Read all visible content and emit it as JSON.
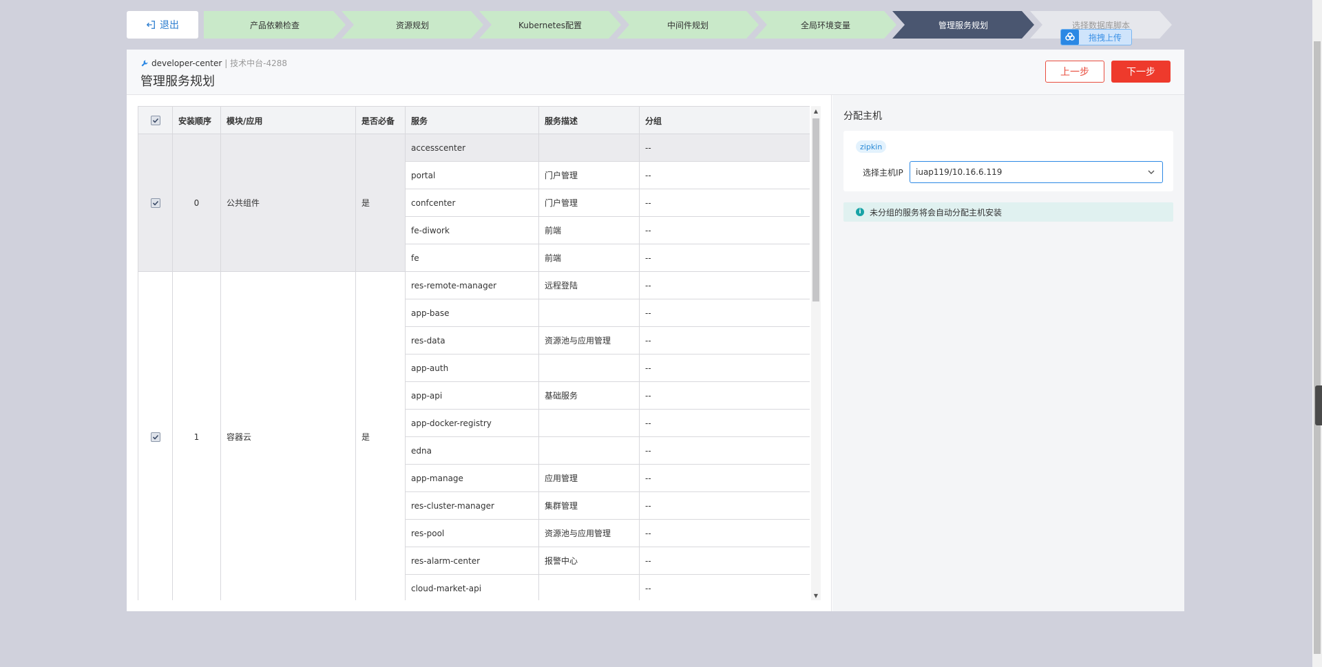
{
  "topbar": {
    "exit_label": "退出",
    "steps": [
      {
        "label": "产品依赖检查",
        "state": "done"
      },
      {
        "label": "资源规划",
        "state": "done"
      },
      {
        "label": "Kubernetes配置",
        "state": "done"
      },
      {
        "label": "中间件规划",
        "state": "done"
      },
      {
        "label": "全局环境变量",
        "state": "done"
      },
      {
        "label": "管理服务规划",
        "state": "active"
      },
      {
        "label": "选择数据库脚本",
        "state": "todo"
      }
    ],
    "upload_label": "拖拽上传"
  },
  "header": {
    "crumb_name": "developer-center",
    "crumb_sub": "| 技术中台-4288",
    "title": "管理服务规划",
    "prev_label": "上一步",
    "next_label": "下一步"
  },
  "table": {
    "columns": [
      "安装顺序",
      "模块/应用",
      "是否必备",
      "服务",
      "服务描述",
      "分组"
    ],
    "groups": [
      {
        "order": "0",
        "module": "公共组件",
        "required": "是",
        "checked": true,
        "rows": [
          {
            "service": "accesscenter",
            "desc": "",
            "group": "--"
          },
          {
            "service": "portal",
            "desc": "门户管理",
            "group": "--"
          },
          {
            "service": "confcenter",
            "desc": "门户管理",
            "group": "--"
          },
          {
            "service": "fe-diwork",
            "desc": "前端",
            "group": "--"
          },
          {
            "service": "fe",
            "desc": "前端",
            "group": "--"
          }
        ]
      },
      {
        "order": "1",
        "module": "容器云",
        "required": "是",
        "checked": true,
        "rows": [
          {
            "service": "res-remote-manager",
            "desc": "远程登陆",
            "group": "--"
          },
          {
            "service": "app-base",
            "desc": "",
            "group": "--"
          },
          {
            "service": "res-data",
            "desc": "资源池与应用管理",
            "group": "--"
          },
          {
            "service": "app-auth",
            "desc": "",
            "group": "--"
          },
          {
            "service": "app-api",
            "desc": "基础服务",
            "group": "--"
          },
          {
            "service": "app-docker-registry",
            "desc": "",
            "group": "--"
          },
          {
            "service": "edna",
            "desc": "",
            "group": "--"
          },
          {
            "service": "app-manage",
            "desc": "应用管理",
            "group": "--"
          },
          {
            "service": "res-cluster-manager",
            "desc": "集群管理",
            "group": "--"
          },
          {
            "service": "res-pool",
            "desc": "资源池与应用管理",
            "group": "--"
          },
          {
            "service": "res-alarm-center",
            "desc": "报警中心",
            "group": "--"
          },
          {
            "service": "cloud-market-api",
            "desc": "",
            "group": "--"
          }
        ]
      }
    ]
  },
  "assign": {
    "title": "分配主机",
    "tag": "zipkin",
    "host_label": "选择主机IP",
    "host_value": "iuap119/10.16.6.119",
    "info": "未分组的服务将会自动分配主机安装"
  },
  "colors": {
    "accent_red": "#ee3a2c",
    "step_done": "#c9e9c9",
    "step_active": "#4a5670",
    "link_blue": "#2a7ccf"
  }
}
